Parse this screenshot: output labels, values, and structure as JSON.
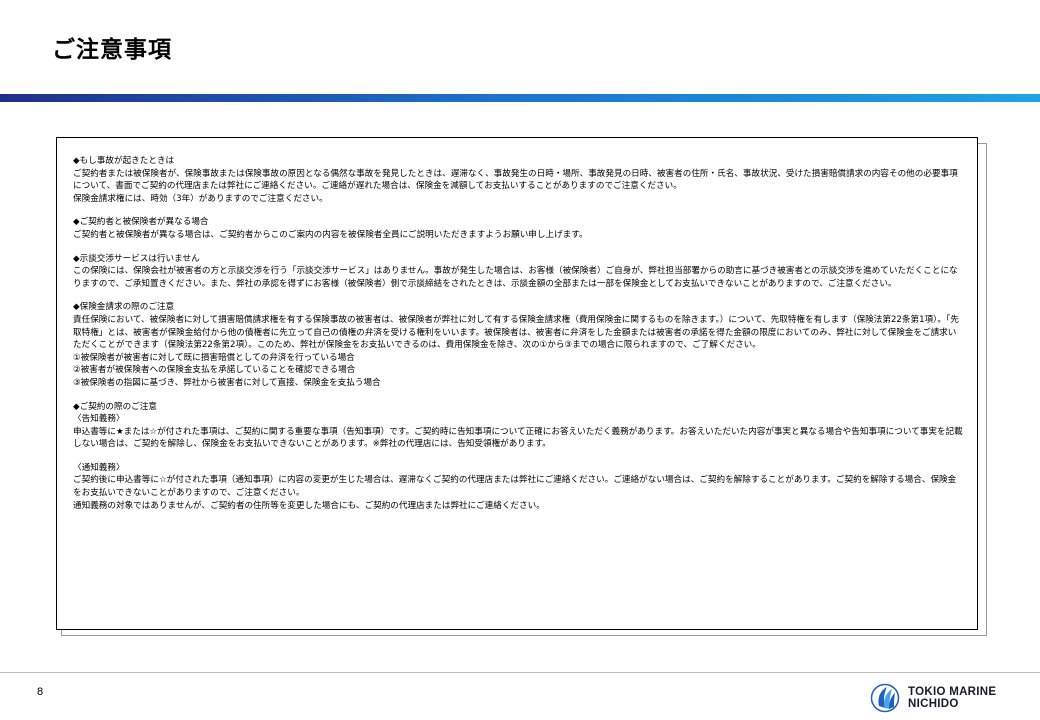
{
  "header": {
    "title": "ご注意事項"
  },
  "sections": [
    {
      "title": "◆もし事故が起きたときは",
      "paragraphs": [
        "ご契約者または被保険者が、保険事故または保険事故の原因となる偶然な事故を発見したときは、遅滞なく、事故発生の日時・場所、事故発見の日時、被害者の住所・氏名、事故状況、受けた損害賠償請求の内容その他の必要事項について、書面でご契約の代理店または弊社にご連絡ください。ご連絡が遅れた場合は、保険金を減額してお支払いすることがありますのでご注意ください。",
        "保険金請求権には、時効（3年）がありますのでご注意ください。"
      ]
    },
    {
      "title": "◆ご契約者と被保険者が異なる場合",
      "paragraphs": [
        "ご契約者と被保険者が異なる場合は、ご契約者からこのご案内の内容を被保険者全員にご説明いただきますようお願い申し上げます。"
      ]
    },
    {
      "title": "◆示談交渉サービスは行いません",
      "paragraphs": [
        "この保険には、保険会社が被害者の方と示談交渉を行う「示談交渉サービス」はありません。事故が発生した場合は、お客様（被保険者）ご自身が、弊社担当部署からの助言に基づき被害者との示談交渉を進めていただくことになりますので、ご承知置きください。また、弊社の承認を得ずにお客様（被保険者）側で示談締結をされたときは、示談金額の全部または一部を保険金としてお支払いできないことがありますので、ご注意ください。"
      ]
    },
    {
      "title": "◆保険金請求の際のご注意",
      "paragraphs": [
        "責任保険において、被保険者に対して損害賠償請求権を有する保険事故の被害者は、被保険者が弊社に対して有する保険金請求権（費用保険金に関するものを除きます。）について、先取特権を有します（保険法第22条第1項）。「先取特権」とは、被害者が保険金給付から他の債権者に先立って自己の債権の弁済を受ける権利をいいます。被保険者は、被害者に弁済をした金額または被害者の承諾を得た金額の限度においてのみ、弊社に対して保険金をご請求いただくことができます（保険法第22条第2項）。このため、弊社が保険金をお支払いできるのは、費用保険金を除き、次の①から③までの場合に限られますので、ご了解ください。",
        "①被保険者が被害者に対して既に損害賠償としての弁済を行っている場合",
        "②被害者が被保険者への保険金支払を承諾していることを確認できる場合",
        "③被保険者の指図に基づき、弊社から被害者に対して直接、保険金を支払う場合"
      ]
    },
    {
      "title": "◆ご契約の際のご注意",
      "subsections": [
        {
          "title": "〈告知義務〉",
          "paragraphs": [
            "申込書等に★または☆が付された事項は、ご契約に関する重要な事項（告知事項）です。ご契約時に告知事項について正確にお答えいただく義務があります。お答えいただいた内容が事実と異なる場合や告知事項について事実を記載しない場合は、ご契約を解除し、保険金をお支払いできないことがあります。※弊社の代理店には、告知受領権があります。"
          ]
        },
        {
          "title": "〈通知義務〉",
          "paragraphs": [
            "ご契約後に申込書等に☆が付された事項（通知事項）に内容の変更が生じた場合は、遅滞なくご契約の代理店または弊社にご連絡ください。ご連絡がない場合は、ご契約を解除することがあります。ご契約を解除する場合、保険金をお支払いできないことがありますので、ご注意ください。",
            "通知義務の対象ではありませんが、ご契約者の住所等を変更した場合にも、ご契約の代理店または弊社にご連絡ください。"
          ]
        }
      ]
    }
  ],
  "footer": {
    "page_number": "8",
    "logo_line1": "TOKIO MARINE",
    "logo_line2": "NICHIDO"
  },
  "colors": {
    "bar_start": "#1e2f8a",
    "bar_end": "#1ea3e6",
    "logo_blue": "#1f5fbf"
  }
}
